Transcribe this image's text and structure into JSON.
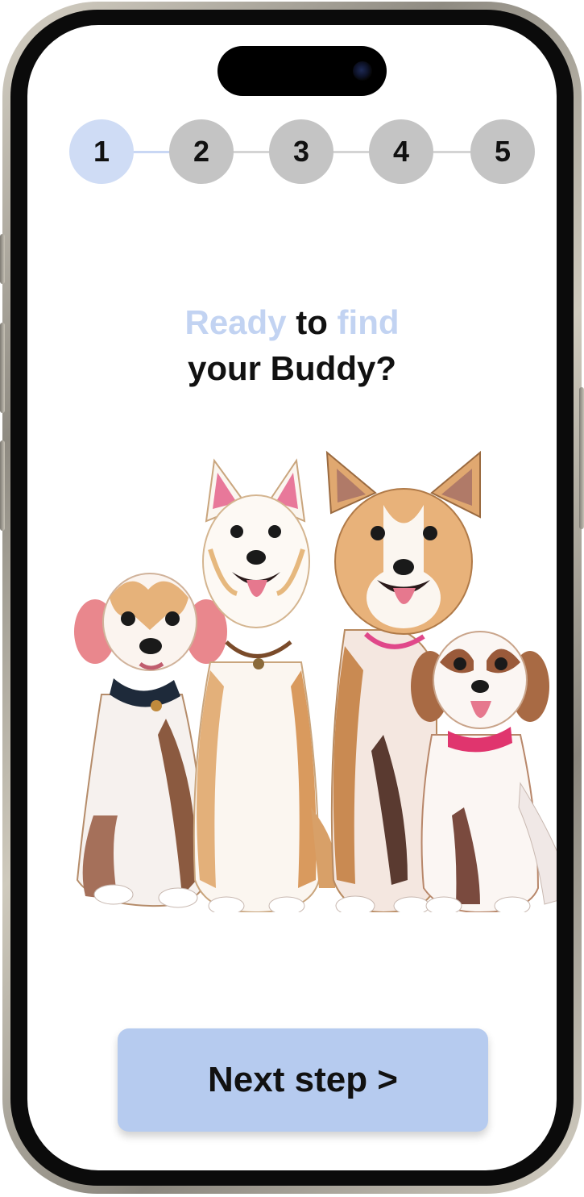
{
  "stepper": {
    "steps": [
      {
        "label": "1",
        "state": "active"
      },
      {
        "label": "2",
        "state": "inactive"
      },
      {
        "label": "3",
        "state": "inactive"
      },
      {
        "label": "4",
        "state": "inactive"
      },
      {
        "label": "5",
        "state": "inactive"
      }
    ],
    "current_step": 1
  },
  "headline": {
    "word1": "Ready",
    "word2": "to",
    "word3": "find",
    "line2": "your Buddy?"
  },
  "illustration": {
    "subject": "four-dogs-illustration"
  },
  "next_button": {
    "label": "Next step >"
  },
  "colors": {
    "accent": "#c2d3f2",
    "button": "#b6cbef",
    "step_active": "#cfdcf5",
    "step_inactive": "#c4c4c4"
  }
}
